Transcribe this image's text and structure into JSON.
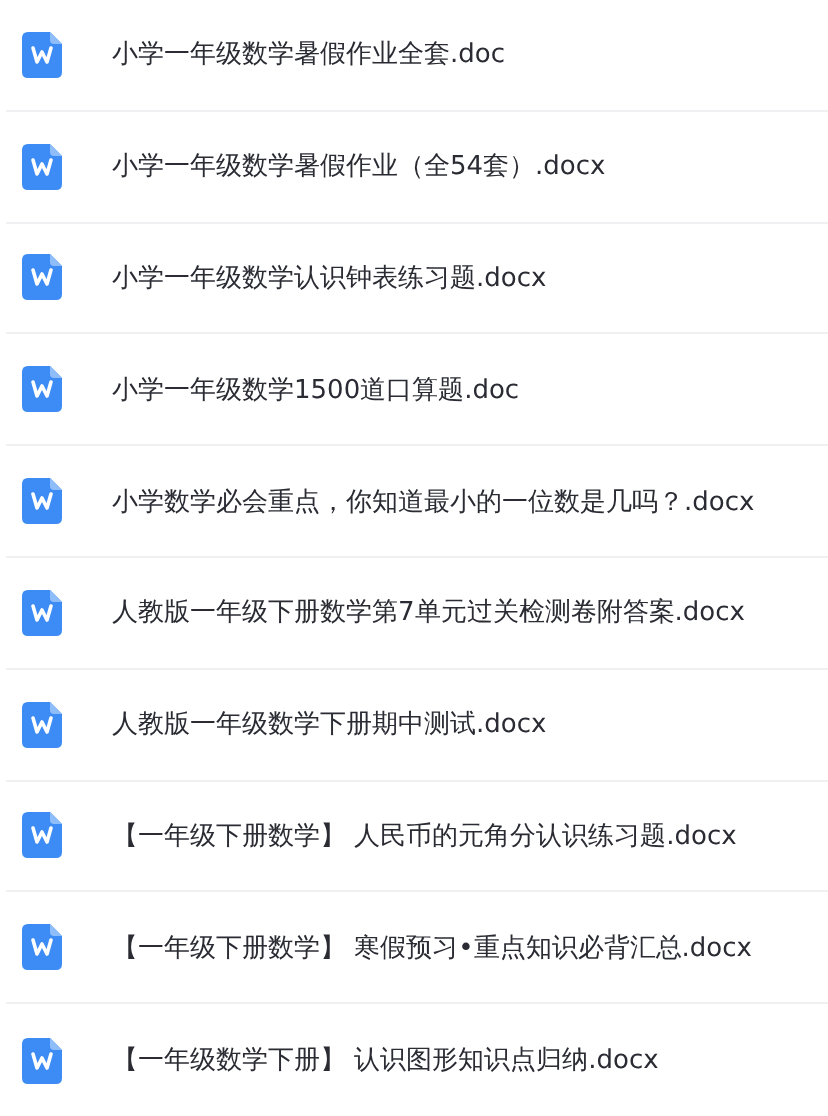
{
  "files": [
    {
      "name": "小学一年级数学暑假作业全套.doc"
    },
    {
      "name": "小学一年级数学暑假作业（全54套）.docx"
    },
    {
      "name": "小学一年级数学认识钟表练习题.docx"
    },
    {
      "name": "小学一年级数学1500道口算题.doc"
    },
    {
      "name": "小学数学必会重点，你知道最小的一位数是几吗？.docx"
    },
    {
      "name": "人教版一年级下册数学第7单元过关检测卷附答案.docx"
    },
    {
      "name": "人教版一年级数学下册期中测试.docx"
    },
    {
      "name": "【一年级下册数学】 人民币的元角分认识练习题.docx"
    },
    {
      "name": "【一年级下册数学】 寒假预习•重点知识必背汇总.docx"
    },
    {
      "name": "【一年级数学下册】 认识图形知识点归纳.docx"
    }
  ]
}
